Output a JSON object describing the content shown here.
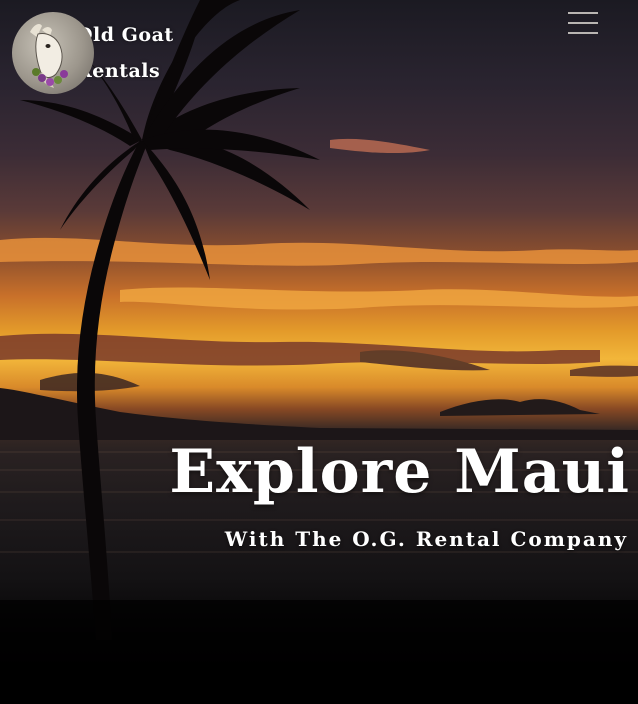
{
  "brand": {
    "name_line1": "Old Goat",
    "name_line2": "Rentals",
    "logo_icon": "goat-logo-icon"
  },
  "nav": {
    "menu_icon": "hamburger-menu-icon"
  },
  "hero": {
    "title": "Explore Maui",
    "subtitle": "With The O.G. Rental Company",
    "background": "sunset-palm-tree-ocean-photo"
  },
  "colors": {
    "sky_orange": "#f2b63a",
    "text": "#ffffff",
    "menu_bars": "#b9b5b2"
  }
}
